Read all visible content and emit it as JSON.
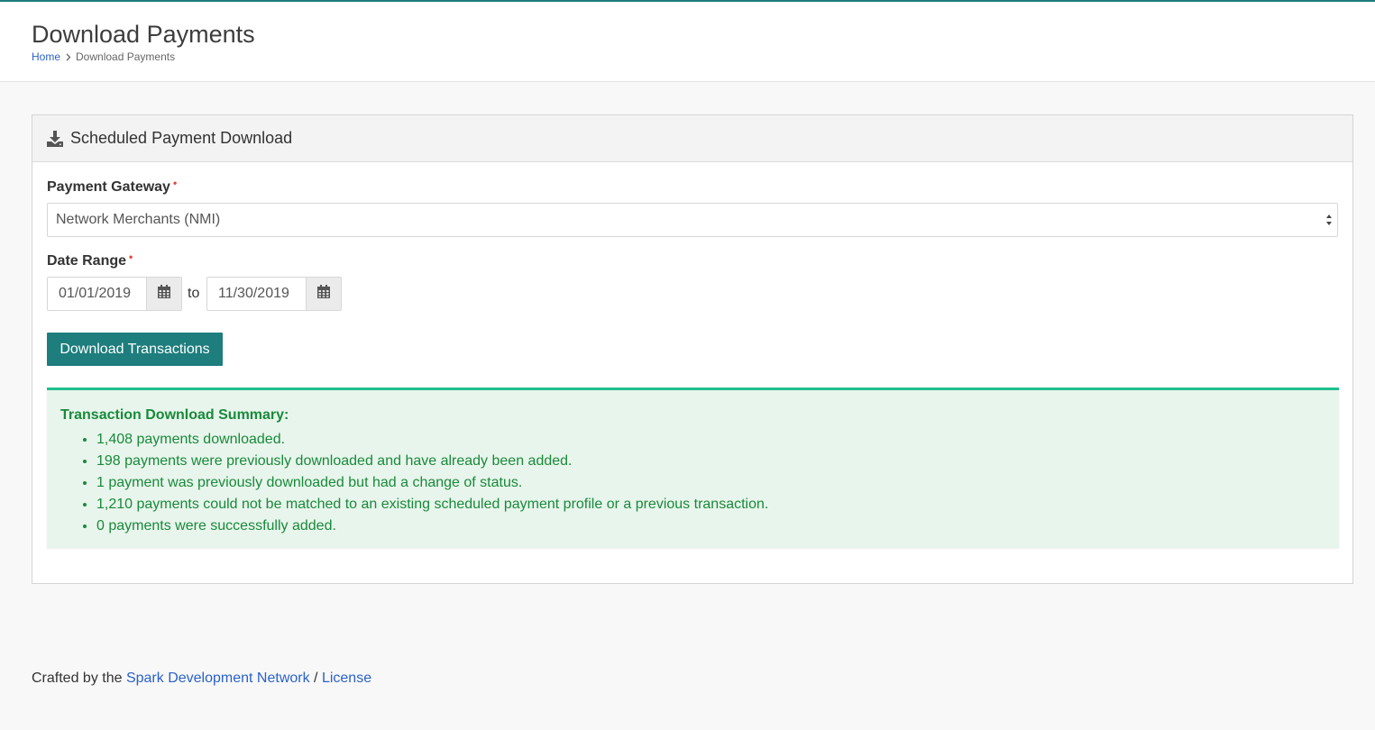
{
  "header": {
    "title": "Download Payments",
    "breadcrumb": {
      "home": "Home",
      "current": "Download Payments"
    }
  },
  "panel": {
    "title": "Scheduled Payment Download",
    "icon": "download-icon",
    "gateway": {
      "label": "Payment Gateway",
      "required_marker": "•",
      "selected": "Network Merchants (NMI)"
    },
    "date_range": {
      "label": "Date Range",
      "required_marker": "•",
      "start": "01/01/2019",
      "separator": "to",
      "end": "11/30/2019"
    },
    "download_button": "Download Transactions",
    "summary": {
      "title": "Transaction Download Summary:",
      "items": [
        "1,408 payments downloaded.",
        "198 payments were previously downloaded and have already been added.",
        "1 payment was previously downloaded but had a change of status.",
        "1,210 payments could not be matched to an existing scheduled payment profile or a previous transaction.",
        "0 payments were successfully added."
      ]
    }
  },
  "footer": {
    "prefix": "Crafted by the",
    "link": "Spark Development Network",
    "separator": "/",
    "license": "License"
  },
  "colors": {
    "accent": "#1e7d7d",
    "success_text": "#188a3a",
    "success_bg": "#e8f5ec",
    "success_border": "#1fbf8c",
    "link": "#2a62c9",
    "required": "#e0493a"
  }
}
